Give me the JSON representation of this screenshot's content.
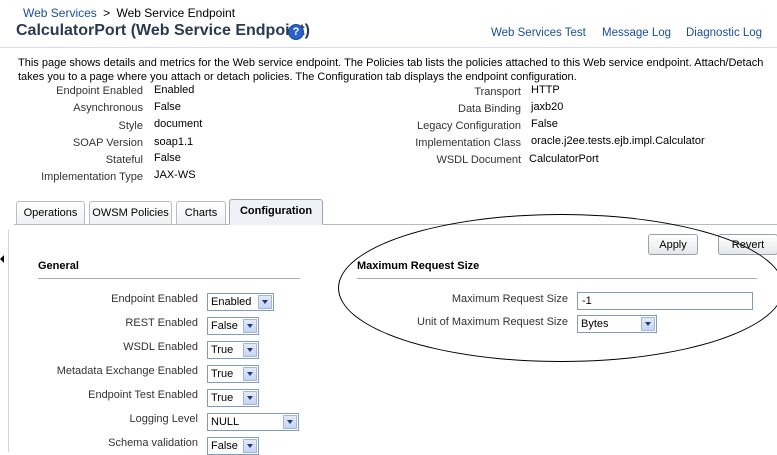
{
  "breadcrumb": {
    "parent": "Web Services",
    "separator": ">",
    "current": "Web Service Endpoint"
  },
  "page_title": "CalculatorPort (Web Service Endpoint)",
  "help_icon_text": "?",
  "top_links": {
    "test": "Web Services Test",
    "log": "Message Log",
    "diag": "Diagnostic Log"
  },
  "description": "This page shows details and metrics for the Web service endpoint. The Policies tab lists the policies attached to this Web service endpoint. Attach/Detach takes you to a page where you attach or detach policies. The Configuration tab displays the endpoint configuration.",
  "properties_left": [
    {
      "label": "Endpoint Enabled",
      "value": "Enabled"
    },
    {
      "label": "Asynchronous",
      "value": "False"
    },
    {
      "label": "Style",
      "value": "document"
    },
    {
      "label": "SOAP Version",
      "value": "soap1.1"
    },
    {
      "label": "Stateful",
      "value": "False"
    },
    {
      "label": "Implementation Type",
      "value": "JAX-WS"
    }
  ],
  "properties_right": [
    {
      "label": "Transport",
      "value": "HTTP"
    },
    {
      "label": "Data Binding",
      "value": "jaxb20"
    },
    {
      "label": "Legacy Configuration",
      "value": "False"
    },
    {
      "label": "Implementation Class",
      "value": "oracle.j2ee.tests.ejb.impl.Calculator"
    },
    {
      "label": "WSDL Document",
      "value": "CalculatorPort"
    }
  ],
  "tabs": [
    {
      "label": "Operations"
    },
    {
      "label": "OWSM Policies"
    },
    {
      "label": "Charts"
    },
    {
      "label": "Configuration",
      "active": true
    }
  ],
  "buttons": {
    "apply": "Apply",
    "revert": "Revert"
  },
  "general": {
    "title": "General",
    "fields": [
      {
        "label": "Endpoint Enabled",
        "value": "Enabled"
      },
      {
        "label": "REST Enabled",
        "value": "False"
      },
      {
        "label": "WSDL Enabled",
        "value": "True"
      },
      {
        "label": "Metadata Exchange Enabled",
        "value": "True"
      },
      {
        "label": "Endpoint Test Enabled",
        "value": "True"
      },
      {
        "label": "Logging Level",
        "value": "NULL"
      },
      {
        "label": "Schema validation",
        "value": "False"
      }
    ]
  },
  "max_request": {
    "title": "Maximum Request Size",
    "size_label": "Maximum Request Size",
    "size_value": "-1",
    "unit_label": "Unit of Maximum Request Size",
    "unit_value": "Bytes"
  }
}
